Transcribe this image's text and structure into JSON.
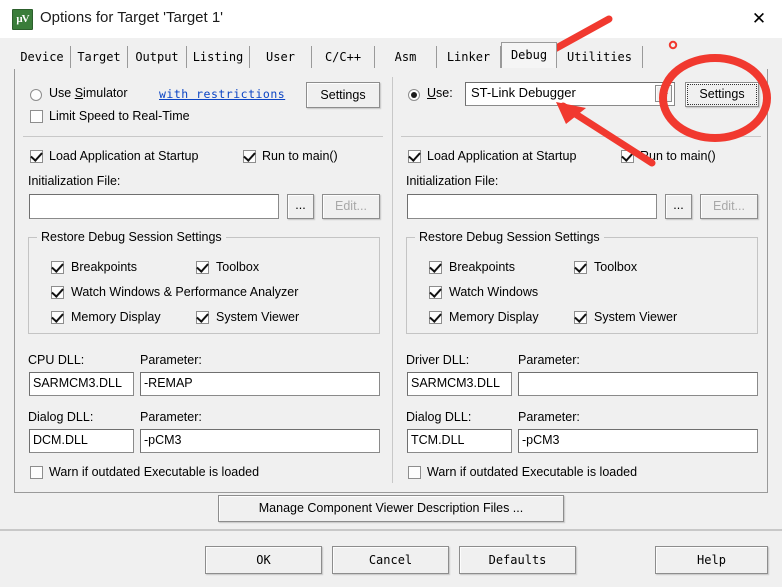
{
  "window": {
    "title": "Options for Target 'Target 1'",
    "icon_name": "uvision-icon",
    "icon_text_mu": "μV",
    "icon_text_sub": "s",
    "close_glyph": "✕"
  },
  "tabs": [
    {
      "label": "Device",
      "active": false
    },
    {
      "label": "Target",
      "active": false
    },
    {
      "label": "Output",
      "active": false
    },
    {
      "label": "Listing",
      "active": false
    },
    {
      "label": "User",
      "active": false
    },
    {
      "label": "C/C++",
      "active": false
    },
    {
      "label": "Asm",
      "active": false
    },
    {
      "label": "Linker",
      "active": false
    },
    {
      "label": "Debug",
      "active": true
    },
    {
      "label": "Utilities",
      "active": false
    }
  ],
  "left": {
    "use_simulator": {
      "label_pre": "Use ",
      "label_u": "S",
      "label_post": "imulator",
      "checked": false
    },
    "restrictions_link": "with restrictions",
    "settings_button": "Settings",
    "limit_speed": {
      "label": "Limit Speed to Real-Time",
      "checked": false
    },
    "load_app": {
      "label": "Load Application at Startup",
      "checked": true
    },
    "run_to_main": {
      "label": "Run to main()",
      "checked": true
    },
    "init_file_label": "Initialization File:",
    "init_file_value": "",
    "browse_button": "...",
    "edit_button": "Edit...",
    "restore_group_title": "Restore Debug Session Settings",
    "restore_items": [
      {
        "label": "Breakpoints",
        "checked": true
      },
      {
        "label": "Toolbox",
        "checked": true
      },
      {
        "label": "Watch Windows & Performance Analyzer",
        "checked": true
      },
      {
        "label": "Memory Display",
        "checked": true
      },
      {
        "label": "System Viewer",
        "checked": true
      }
    ],
    "cpu_dll_label": "CPU DLL:",
    "cpu_dll_value": "SARMCM3.DLL",
    "cpu_param_label": "Parameter:",
    "cpu_param_value": "-REMAP",
    "dialog_dll_label": "Dialog DLL:",
    "dialog_dll_value": "DCM.DLL",
    "dialog_param_label": "Parameter:",
    "dialog_param_value": "-pCM3",
    "warn_outdated": {
      "label": "Warn if outdated Executable is loaded",
      "checked": false
    }
  },
  "right": {
    "use_radio": {
      "label_u": "U",
      "label_post": "se:",
      "checked": true
    },
    "debugger_select": "ST-Link Debugger",
    "settings_button": "Settings",
    "load_app": {
      "label": "Load Application at Startup",
      "checked": true
    },
    "run_to_main": {
      "label": "Run to main()",
      "checked": true
    },
    "init_file_label": "Initialization File:",
    "init_file_value": "",
    "browse_button": "...",
    "edit_button": "Edit...",
    "restore_group_title": "Restore Debug Session Settings",
    "restore_items": [
      {
        "label": "Breakpoints",
        "checked": true
      },
      {
        "label": "Toolbox",
        "checked": true
      },
      {
        "label": "Watch Windows",
        "checked": true
      },
      {
        "label": "Memory Display",
        "checked": true
      },
      {
        "label": "System Viewer",
        "checked": true
      }
    ],
    "driver_dll_label": "Driver DLL:",
    "driver_dll_value": "SARMCM3.DLL",
    "driver_param_label": "Parameter:",
    "driver_param_value": "",
    "dialog_dll_label": "Dialog DLL:",
    "dialog_dll_value": "TCM.DLL",
    "dialog_param_label": "Parameter:",
    "dialog_param_value": "-pCM3",
    "warn_outdated": {
      "label": "Warn if outdated Executable is loaded",
      "checked": false
    }
  },
  "footer": {
    "manage_button": "Manage Component Viewer Description Files ...",
    "ok_button": "OK",
    "cancel_button": "Cancel",
    "defaults_button": "Defaults",
    "help_button": "Help"
  },
  "annotations": {
    "color": "#f1392f",
    "arrow_to_debug_tab": "arrow-pointing-to-debug-tab",
    "arrow_to_debugger_select": "arrow-pointing-to-debugger-dropdown",
    "circle_around_settings": "circle-highlight-settings-button",
    "dot": "red-dot-marker"
  }
}
